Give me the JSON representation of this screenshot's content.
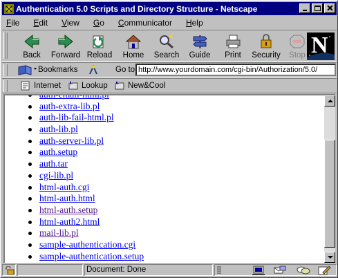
{
  "window": {
    "title": "Authentication 5.0 Scripts and Directory Structure - Netscape"
  },
  "menu": [
    {
      "label": "File",
      "key": "F"
    },
    {
      "label": "Edit",
      "key": "E"
    },
    {
      "label": "View",
      "key": "V"
    },
    {
      "label": "Go",
      "key": "G"
    },
    {
      "label": "Communicator",
      "key": "C"
    },
    {
      "label": "Help",
      "key": "H"
    }
  ],
  "toolbar": {
    "back": "Back",
    "forward": "Forward",
    "reload": "Reload",
    "home": "Home",
    "search": "Search",
    "guide": "Guide",
    "print": "Print",
    "security": "Security",
    "stop": "Stop"
  },
  "location": {
    "bookmarks_label": "Bookmarks",
    "goto_label": "Go to:",
    "url": "http://www.yourdomain.com/cgi-bin/Authorization/5.0/"
  },
  "personal_toolbar": {
    "internet": "Internet",
    "lookup": "Lookup",
    "newcool": "New&Cool"
  },
  "files": [
    {
      "name": "auth-email-html.pl",
      "visited": false
    },
    {
      "name": "auth-extra-lib.pl",
      "visited": false
    },
    {
      "name": "auth-lib-fail-html.pl",
      "visited": false
    },
    {
      "name": "auth-lib.pl",
      "visited": false
    },
    {
      "name": "auth-server-lib.pl",
      "visited": false
    },
    {
      "name": "auth.setup",
      "visited": false
    },
    {
      "name": "auth.tar",
      "visited": false
    },
    {
      "name": "cgi-lib.pl",
      "visited": false
    },
    {
      "name": "html-auth.cgi",
      "visited": false
    },
    {
      "name": "html-auth.html",
      "visited": false
    },
    {
      "name": "html-auth.setup",
      "visited": true
    },
    {
      "name": "html-auth2.html",
      "visited": false
    },
    {
      "name": "mail-lib.pl",
      "visited": true
    },
    {
      "name": "sample-authentication.cgi",
      "visited": false
    },
    {
      "name": "sample-authentication.setup",
      "visited": false
    }
  ],
  "status": {
    "text": "Document: Done"
  },
  "colors": {
    "link": "#0000ee",
    "visited": "#551a8b",
    "titlebar": "#000080"
  }
}
